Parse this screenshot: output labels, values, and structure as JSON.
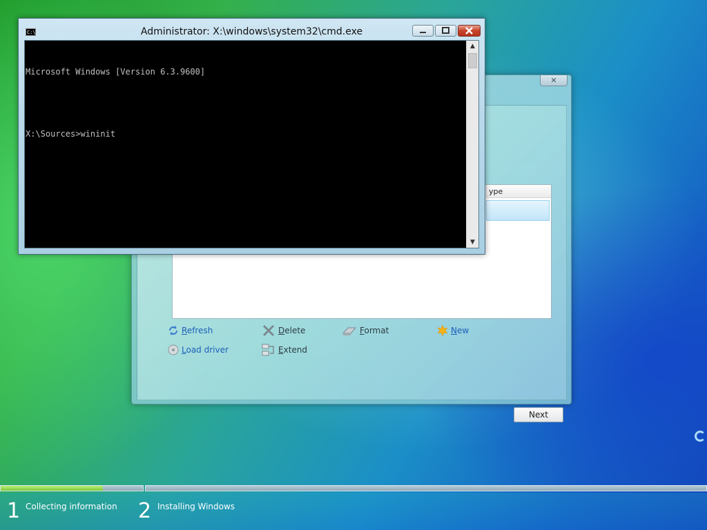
{
  "cmd_window": {
    "title": "Administrator: X:\\windows\\system32\\cmd.exe",
    "icon_text": "C:\\",
    "console_lines": [
      "Microsoft Windows [Version 6.3.9600]",
      "",
      "X:\\Sources>wininit"
    ]
  },
  "setup_dialog": {
    "column_header": "ype",
    "actions": {
      "refresh": "Refresh",
      "delete": "Delete",
      "format": "Format",
      "new": "New",
      "load_driver": "Load driver",
      "extend": "Extend"
    },
    "next_label": "Next"
  },
  "steps": [
    {
      "number": "1",
      "label": "Collecting information"
    },
    {
      "number": "2",
      "label": "Installing Windows"
    }
  ],
  "progress": {
    "collecting_information_fraction": 0.72
  },
  "icons": {
    "refresh": "refresh-icon",
    "delete": "delete-x-icon",
    "format": "eraser-icon",
    "new": "starburst-icon",
    "load_driver": "disc-icon",
    "extend": "extend-icon"
  },
  "colors": {
    "link": "#1c5fb8",
    "progress_fill": "#7dc83a",
    "console_bg": "#000000",
    "console_text": "#c0c0c0"
  }
}
